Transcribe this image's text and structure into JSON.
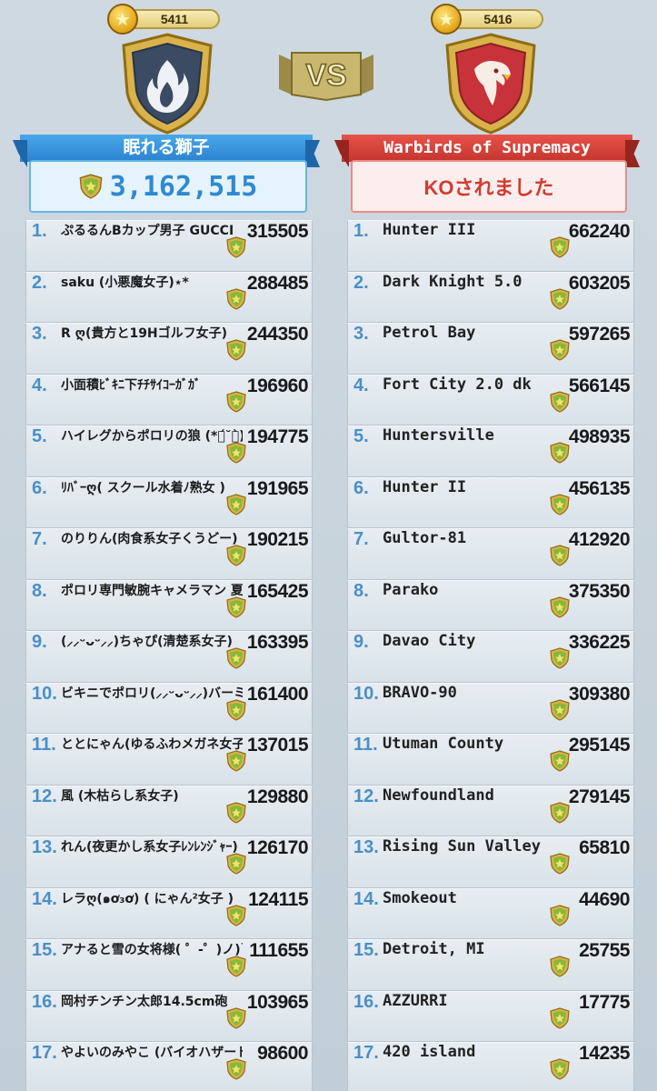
{
  "left_team": {
    "trophies": "5411",
    "name": "眠れる獅子",
    "total_score": "3,162,515",
    "emblem": "flame-shield-icon",
    "color": "#2f8ad1"
  },
  "right_team": {
    "trophies": "5416",
    "name": "Warbirds of Supremacy",
    "status": "KOされました",
    "emblem": "eagle-shield-icon",
    "color": "#d33a30"
  },
  "vs_label": "VS",
  "left_members": [
    {
      "rank": "1.",
      "name": "ぷるるんBカップ男子 GUCCI",
      "score": "315505"
    },
    {
      "rank": "2.",
      "name": "saku (小悪魔女子)⋆*",
      "score": "288485"
    },
    {
      "rank": "3.",
      "name": "R ღ(貴方と19Hゴルフ女子)",
      "score": "244350"
    },
    {
      "rank": "4.",
      "name": "小面積ﾋﾞｷﾆ下ﾁﾁｻｲｺｰｶﾞｶﾞ",
      "score": "196960"
    },
    {
      "rank": "5.",
      "name": "ハイレグからポロリの狼 (*ฅ́˘ฅ̀)",
      "score": "194775"
    },
    {
      "rank": "6.",
      "name": "ﾘﾊﾞｰღ( スクール水着ﾉ熟女 )",
      "score": "191965"
    },
    {
      "rank": "7.",
      "name": "のりりん(肉食系女子くうどー)",
      "score": "190215"
    },
    {
      "rank": "8.",
      "name": "ポロリ専門敏腕キャメラマン 夏乃早漏",
      "score": "165425"
    },
    {
      "rank": "9.",
      "name": "(⸝⸝ᵕᴗᵕ⸝⸝)ちゃぴ(清楚系女子)",
      "score": "163395"
    },
    {
      "rank": "10.",
      "name": "ビキニでポロリ(⸝⸝ᵕᴗᵕ⸝⸝)バーミィ",
      "score": "161400"
    },
    {
      "rank": "11.",
      "name": "ととにゃん(ゆるふわメガネ女子)",
      "score": "137015"
    },
    {
      "rank": "12.",
      "name": "風 (木枯らし系女子)",
      "score": "129880"
    },
    {
      "rank": "13.",
      "name": "れん(夜更かし系女子ﾚﾝﾚﾝｼﾞｬｰ)",
      "score": "126170"
    },
    {
      "rank": "14.",
      "name": "レラღ(๑ơ₃ơ) ( にゃん²女子 )",
      "score": "124115"
    },
    {
      "rank": "15.",
      "name": "アナると雪の女将様( ゜-゜)ノ)`",
      "score": "111655"
    },
    {
      "rank": "16.",
      "name": "岡村チンチン太郎14.5cm砲",
      "score": "103965"
    },
    {
      "rank": "17.",
      "name": "やよいのみやこ (バイオハザード系女子)",
      "score": "98600"
    }
  ],
  "right_members": [
    {
      "rank": "1.",
      "name": "Hunter III",
      "score": "662240"
    },
    {
      "rank": "2.",
      "name": "Dark Knight 5.0",
      "score": "603205"
    },
    {
      "rank": "3.",
      "name": "Petrol Bay",
      "score": "597265"
    },
    {
      "rank": "4.",
      "name": "Fort City 2.0 dk",
      "score": "566145"
    },
    {
      "rank": "5.",
      "name": "Huntersville",
      "score": "498935"
    },
    {
      "rank": "6.",
      "name": "Hunter II",
      "score": "456135"
    },
    {
      "rank": "7.",
      "name": "Gultor-81",
      "score": "412920"
    },
    {
      "rank": "8.",
      "name": "Parako",
      "score": "375350"
    },
    {
      "rank": "9.",
      "name": "Davao City",
      "score": "336225"
    },
    {
      "rank": "10.",
      "name": "BRAVO-90",
      "score": "309380"
    },
    {
      "rank": "11.",
      "name": "Utuman County",
      "score": "295145"
    },
    {
      "rank": "12.",
      "name": "Newfoundland",
      "score": "279145"
    },
    {
      "rank": "13.",
      "name": "Rising Sun Valley",
      "score": "65810"
    },
    {
      "rank": "14.",
      "name": "Smokeout",
      "score": "44690"
    },
    {
      "rank": "15.",
      "name": "Detroit, MI",
      "score": "25755"
    },
    {
      "rank": "16.",
      "name": "AZZURRI",
      "score": "17775"
    },
    {
      "rank": "17.",
      "name": "420 island",
      "score": "14235"
    }
  ]
}
